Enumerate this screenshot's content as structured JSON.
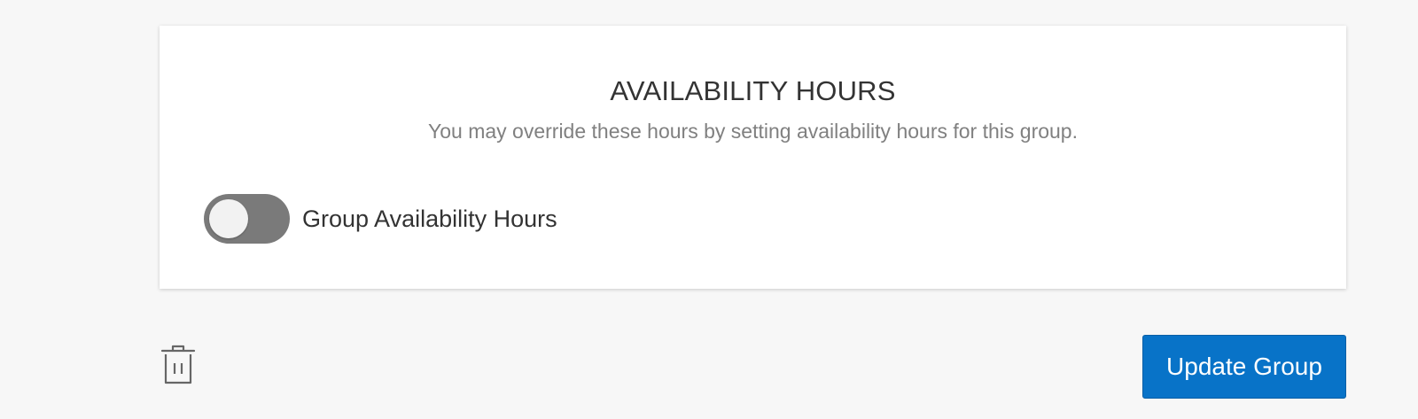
{
  "availability_card": {
    "title": "AVAILABILITY HOURS",
    "subtitle": "You may override these hours by setting availability hours for this group.",
    "toggle": {
      "label": "Group Availability Hours",
      "enabled": false
    }
  },
  "actions": {
    "delete_icon": "trash-icon",
    "update_label": "Update Group"
  },
  "colors": {
    "primary": "#0873c8",
    "toggle_off": "#7a7a7a",
    "background": "#f7f7f7"
  }
}
